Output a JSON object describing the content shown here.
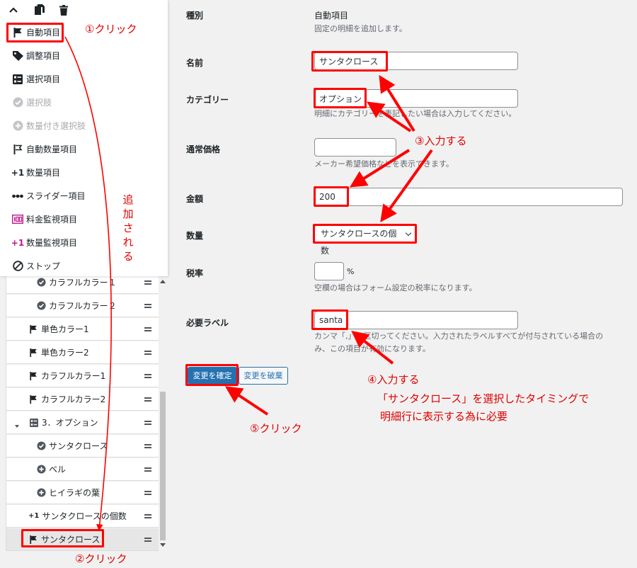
{
  "menu": {
    "items": [
      {
        "label": "自動項目",
        "icon": "flag-icon",
        "disabled": false
      },
      {
        "label": "調整項目",
        "icon": "tag-icon",
        "disabled": false
      },
      {
        "label": "選択項目",
        "icon": "list-icon",
        "disabled": false
      },
      {
        "label": "選択肢",
        "icon": "check-circle-icon",
        "disabled": true
      },
      {
        "label": "数量付き選択肢",
        "icon": "plus-circle-icon",
        "disabled": true
      },
      {
        "label": "自動数量項目",
        "icon": "flag-outline-icon",
        "disabled": false
      },
      {
        "label": "数量項目",
        "icon": "plus-one-icon",
        "disabled": false
      },
      {
        "label": "スライダー項目",
        "icon": "slider-icon",
        "disabled": false
      },
      {
        "label": "料金監視項目",
        "icon": "price-watch-icon",
        "disabled": false
      },
      {
        "label": "数量監視項目",
        "icon": "plus-one-pink-icon",
        "disabled": false
      },
      {
        "label": "ストップ",
        "icon": "stop-icon",
        "disabled": false
      }
    ],
    "plus_one": "+1"
  },
  "tree": {
    "rows": [
      {
        "label": "カラフルカラー１",
        "icon": "check-circle-icon",
        "indent": 2
      },
      {
        "label": "カラフルカラー２",
        "icon": "check-circle-icon",
        "indent": 2
      },
      {
        "label": "単色カラー1",
        "icon": "flag-icon",
        "indent": 1
      },
      {
        "label": "単色カラー2",
        "icon": "flag-icon",
        "indent": 1
      },
      {
        "label": "カラフルカラー1",
        "icon": "flag-icon",
        "indent": 1
      },
      {
        "label": "カラフルカラー2",
        "icon": "flag-icon",
        "indent": 1
      },
      {
        "label": "3．オプション",
        "icon": "list-icon",
        "indent": 0
      },
      {
        "label": "サンタクロース",
        "icon": "check-circle-icon",
        "indent": 2
      },
      {
        "label": "ベル",
        "icon": "plus-circle-icon",
        "indent": 2
      },
      {
        "label": "ヒイラギの葉",
        "icon": "plus-circle-icon",
        "indent": 2
      },
      {
        "label": "サンタクロースの個数",
        "icon": "plus-one-icon",
        "indent": 1
      },
      {
        "label": "サンタクロース",
        "icon": "flag-icon",
        "indent": 1
      }
    ]
  },
  "form": {
    "type_label": "種別",
    "type_value": "自動項目",
    "type_help": "固定の明細を追加します。",
    "name_label": "名前",
    "name_value": "サンタクロース",
    "category_label": "カテゴリー",
    "category_value": "オプション",
    "category_help": "明細にカテゴリーを表記したい場合は入力してください。",
    "normal_price_label": "通常価格",
    "normal_price_value": "",
    "normal_price_help": "メーカー希望価格などを表示できます。",
    "amount_label": "金額",
    "amount_value": "200",
    "quantity_label": "数量",
    "quantity_value": "サンタクロースの個数",
    "tax_label": "税率",
    "tax_value": "",
    "tax_unit": "%",
    "tax_help": "空欄の場合はフォーム設定の税率になります。",
    "required_label_label": "必要ラベル",
    "required_label_value": "santa",
    "required_label_help_1": "カンマ「,」で区切ってください。入力されたラベルすべてが付与されている場合の",
    "required_label_help_2": "み、この項目が有効になります。",
    "apply_button": "変更を確定",
    "discard_button": "変更を破棄"
  },
  "annotations": {
    "step1": "①クリック",
    "step2": "②クリック",
    "step3": "③入力する",
    "step4": "④入力する",
    "step4_note_1": "「サンタクロース」を選択したタイミングで",
    "step4_note_2": "明細行に表示する為に必要",
    "step5": "⑤クリック",
    "added_chars": [
      "追",
      "加",
      "さ",
      "れ",
      "る"
    ],
    "color": "#ff0000"
  }
}
